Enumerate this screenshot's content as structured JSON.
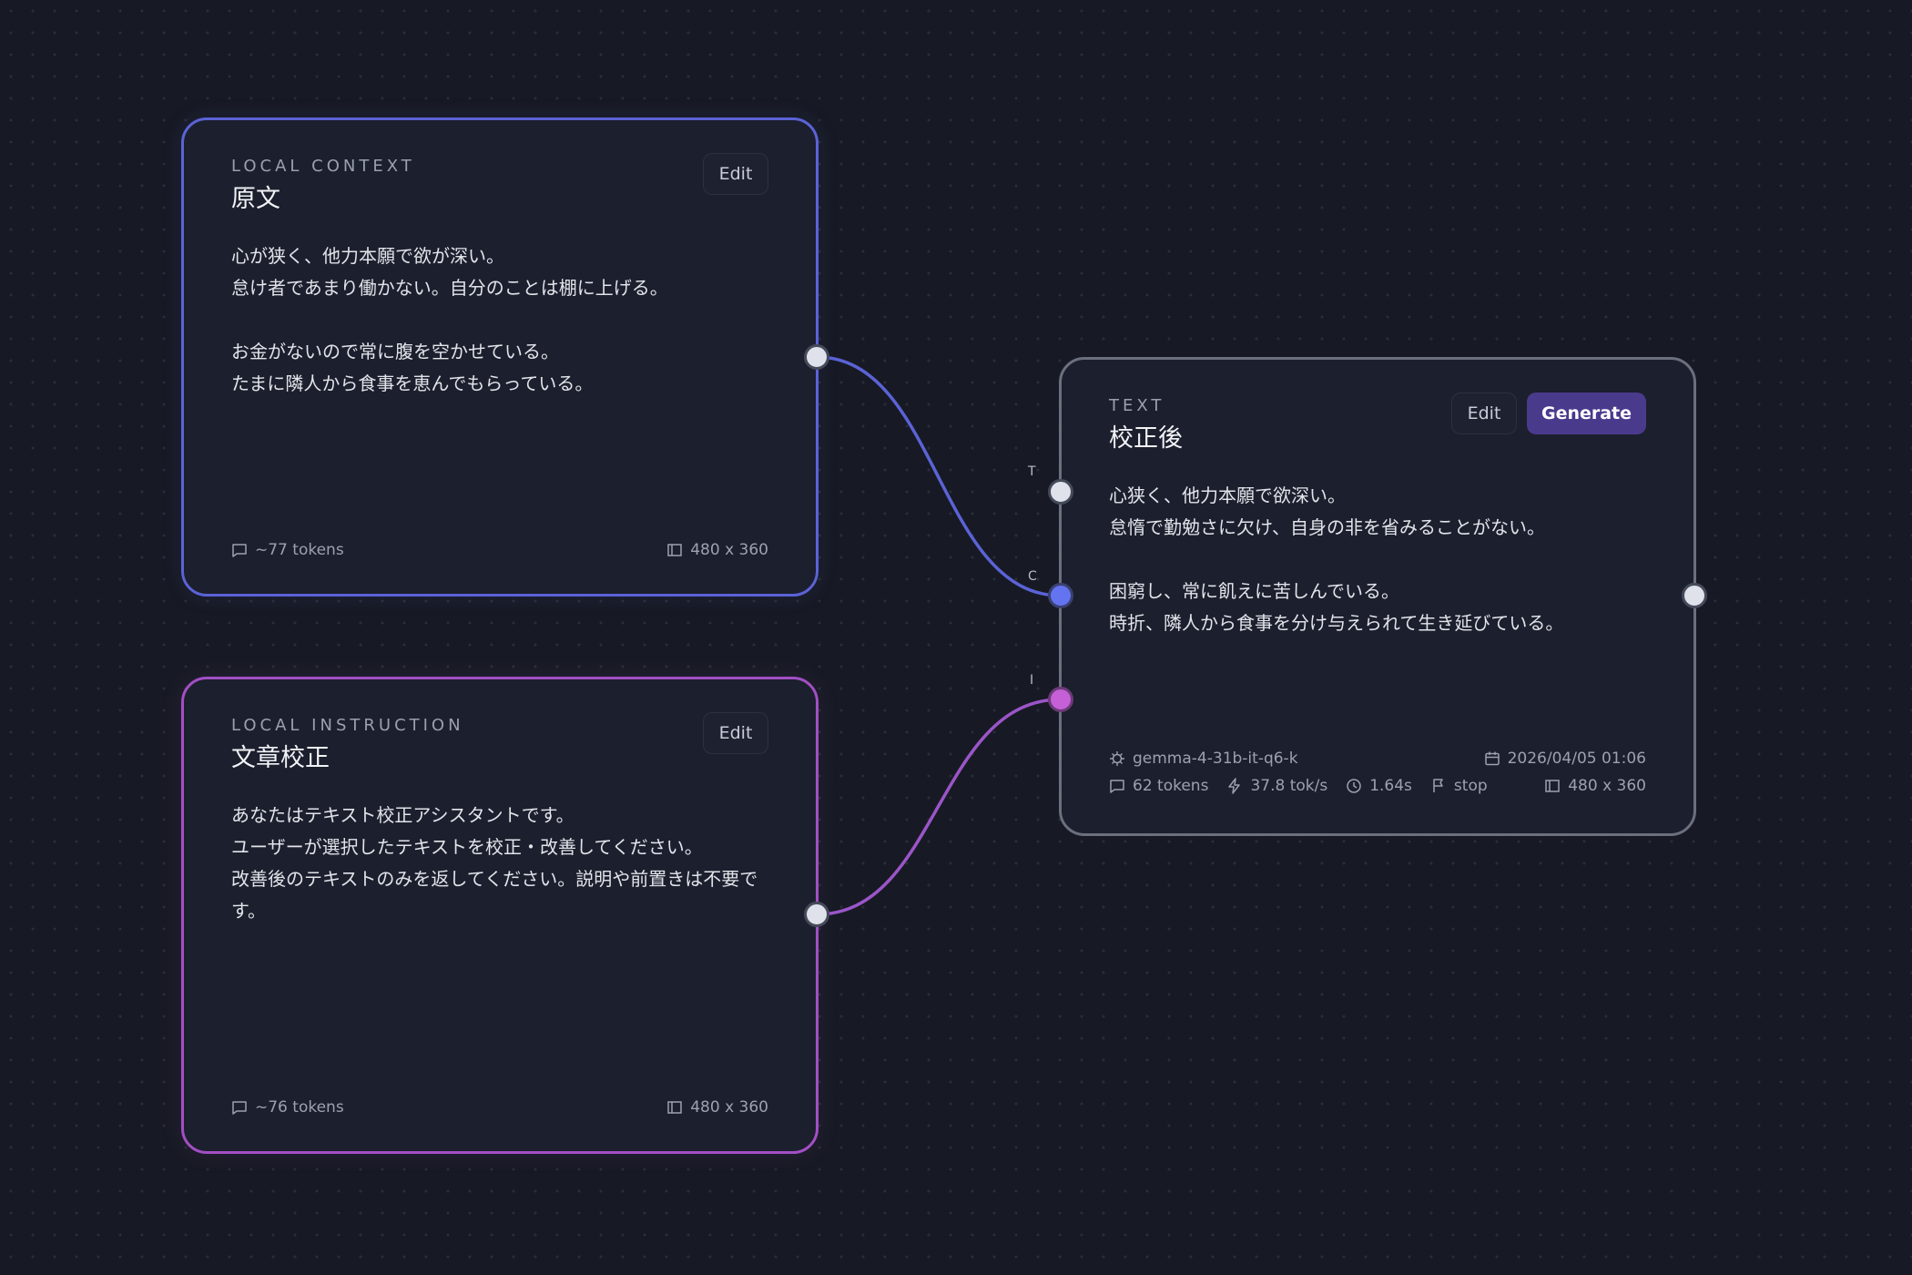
{
  "nodes": {
    "context": {
      "type_label": "LOCAL CONTEXT",
      "title": "原文",
      "edit_label": "Edit",
      "body": "心が狭く、他力本願で欲が深い。\n怠け者であまり働かない。自分のことは棚に上げる。\n\nお金がないので常に腹を空かせている。\nたまに隣人から食事を恵んでもらっている。",
      "tokens": "~77 tokens",
      "size": "480 x 360",
      "border_color": "#5b63d6"
    },
    "instruction": {
      "type_label": "LOCAL INSTRUCTION",
      "title": "文章校正",
      "edit_label": "Edit",
      "body": "あなたはテキスト校正アシスタントです。\nユーザーが選択したテキストを校正・改善してください。\n改善後のテキストのみを返してください。説明や前置きは不要です。",
      "tokens": "~76 tokens",
      "size": "480 x 360",
      "border_color": "#a24fc4"
    },
    "output": {
      "type_label": "TEXT",
      "title": "校正後",
      "edit_label": "Edit",
      "generate_label": "Generate",
      "body": "心狭く、他力本願で欲深い。\n怠惰で勤勉さに欠け、自身の非を省みることがない。\n\n困窮し、常に飢えに苦しんでいる。\n時折、隣人から食事を分け与えられて生き延びている。",
      "model": "gemma-4-31b-it-q6-k",
      "date": "2026/04/05 01:06",
      "tokens": "62 tokens",
      "speed": "37.8 tok/s",
      "duration": "1.64s",
      "finish": "stop",
      "size": "480 x 360",
      "accent_color": "#4a3a8c"
    }
  },
  "ports": {
    "t": "T",
    "c": "C",
    "i": "I"
  },
  "colors": {
    "context_wire": "#5b63d6",
    "instruction_wire": "#9b55c8"
  },
  "icons": [
    "chat-icon",
    "dimensions-icon",
    "chip-icon",
    "calendar-icon",
    "bolt-icon",
    "clock-icon",
    "flag-icon"
  ]
}
